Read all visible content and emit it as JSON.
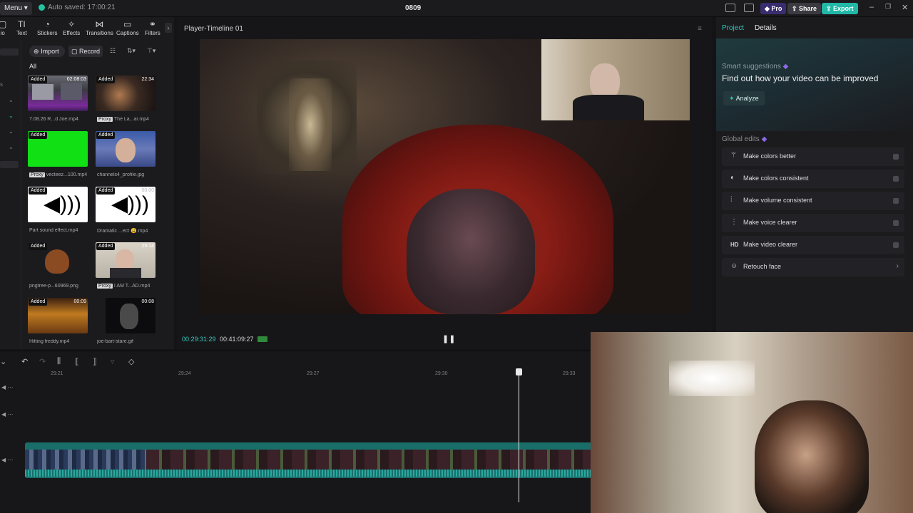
{
  "topbar": {
    "menu_label": "Menu",
    "autosave_text": "Auto saved: 17:00:21",
    "project_name": "0809",
    "pro_label": "Pro",
    "share_label": "Share",
    "export_label": "Export"
  },
  "toolbar": {
    "items": [
      "io",
      "Text",
      "Stickers",
      "Effects",
      "Transitions",
      "Captions",
      "Filters"
    ]
  },
  "media": {
    "import_label": "Import",
    "record_label": "Record",
    "tab_all": "All",
    "items": [
      {
        "badge": "Added",
        "duration": "02:08:03",
        "name": "7.08.26 R...d Joe.mp4",
        "proxy": ""
      },
      {
        "badge": "Added",
        "duration": "22:34",
        "name": "The La...ar.mp4",
        "proxy": "Proxy"
      },
      {
        "badge": "Added",
        "duration": "",
        "name": "vecteez...100.mp4",
        "proxy": "Proxy"
      },
      {
        "badge": "Added",
        "duration": "",
        "name": "channels4_profile.jpg",
        "proxy": ""
      },
      {
        "badge": "Added",
        "duration": "",
        "name": "Part sound effect.mp4",
        "proxy": ""
      },
      {
        "badge": "Added",
        "duration": "00:00",
        "name": "Dramatic ...ect 😩.mp4",
        "proxy": ""
      },
      {
        "badge": "Added",
        "duration": "",
        "name": "pngtree-p...60969.png",
        "proxy": ""
      },
      {
        "badge": "Added",
        "duration": "29:14",
        "name": "I AM T...AD.mp4",
        "proxy": "Proxy"
      },
      {
        "badge": "Added",
        "duration": "00:09",
        "name": "Hitting freddy.mp4",
        "proxy": ""
      },
      {
        "badge": "",
        "duration": "00:08",
        "name": "joe-bart-stare.gif",
        "proxy": ""
      }
    ]
  },
  "player": {
    "title": "Player-Timeline 01",
    "current_time": "00:29:31:29",
    "total_time": "00:41:09:27"
  },
  "right_panel": {
    "tab_project": "Project",
    "tab_details": "Details",
    "smart_title": "Smart suggestions",
    "smart_subtitle": "Find out how your video can be improved",
    "analyze_label": "Analyze",
    "global_title": "Global edits",
    "global_items": [
      {
        "icon": "magic-wand-icon",
        "label": "Make colors better"
      },
      {
        "icon": "palette-icon",
        "label": "Make colors consistent"
      },
      {
        "icon": "sliders-icon",
        "label": "Make volume consistent"
      },
      {
        "icon": "waveform-icon",
        "label": "Make voice clearer"
      },
      {
        "icon": "hd-icon",
        "label": "Make video clearer"
      },
      {
        "icon": "face-icon",
        "label": "Retouch face"
      }
    ]
  },
  "timeline": {
    "ruler": [
      "29:21",
      "29:24",
      "29:27",
      "29:30",
      "29:33"
    ]
  },
  "colors": {
    "accent": "#25c2a0",
    "pro": "#5b3fd4",
    "clip": "#1a6e6a"
  }
}
